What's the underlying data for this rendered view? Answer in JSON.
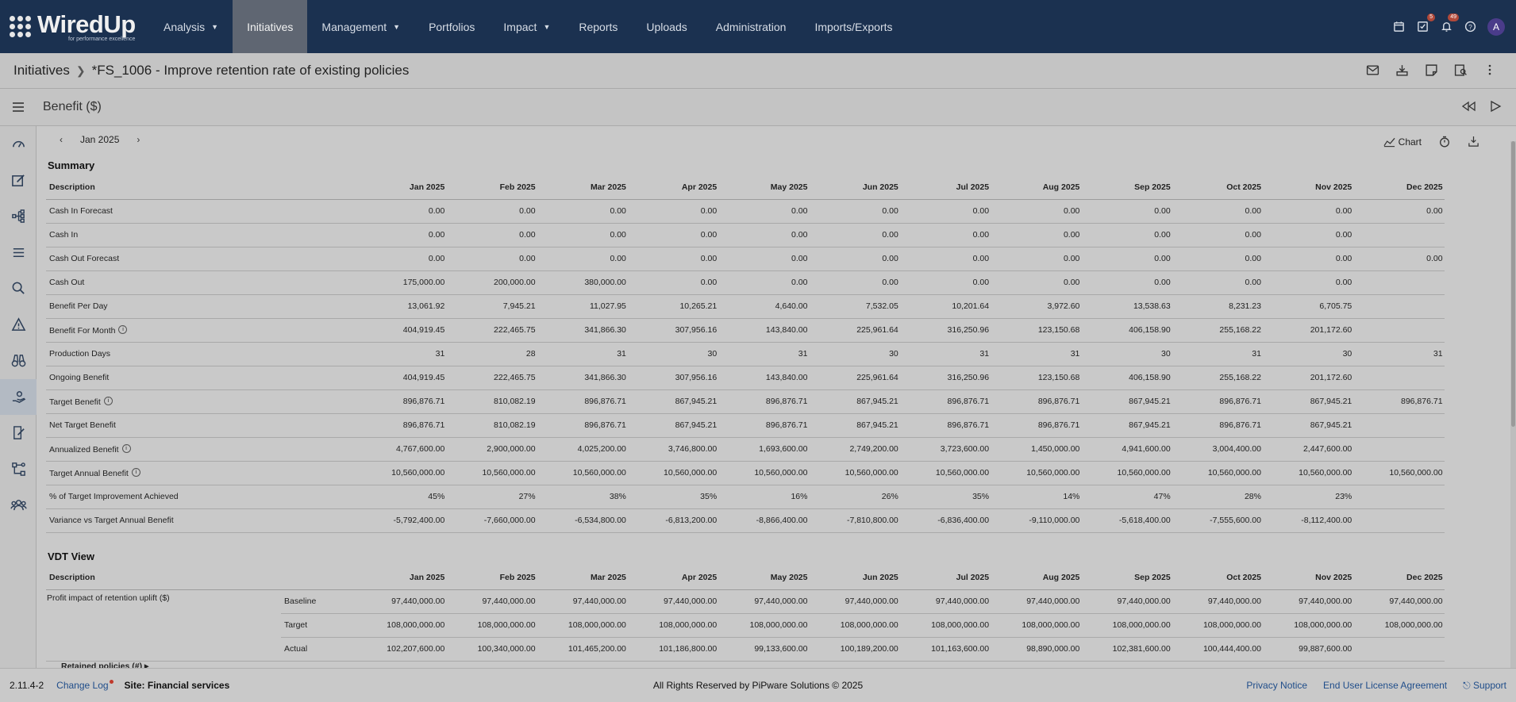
{
  "nav": {
    "logo_text": "WiredUp",
    "logo_tagline": "for performance excellence",
    "items": [
      {
        "label": "Analysis",
        "caret": true
      },
      {
        "label": "Initiatives",
        "caret": false,
        "active": true
      },
      {
        "label": "Management",
        "caret": true
      },
      {
        "label": "Portfolios",
        "caret": false
      },
      {
        "label": "Impact",
        "caret": true
      },
      {
        "label": "Reports",
        "caret": false
      },
      {
        "label": "Uploads",
        "caret": false
      },
      {
        "label": "Administration",
        "caret": false
      },
      {
        "label": "Imports/Exports",
        "caret": false
      }
    ],
    "badge_tasks": "5",
    "badge_notifications": "49",
    "avatar_initial": "A"
  },
  "breadcrumb": {
    "root": "Initiatives",
    "current": "*FS_1006 - Improve retention rate of existing policies"
  },
  "section": {
    "title": "Benefit ($)"
  },
  "period": {
    "label": "Jan 2025"
  },
  "toolbar": {
    "chart_label": "Chart"
  },
  "summary": {
    "title": "Summary",
    "description_header": "Description",
    "months": [
      "Jan 2025",
      "Feb 2025",
      "Mar 2025",
      "Apr 2025",
      "May 2025",
      "Jun 2025",
      "Jul 2025",
      "Aug 2025",
      "Sep 2025",
      "Oct 2025",
      "Nov 2025",
      "Dec 2025"
    ],
    "rows": [
      {
        "label": "Cash In Forecast",
        "info": false,
        "values": [
          "0.00",
          "0.00",
          "0.00",
          "0.00",
          "0.00",
          "0.00",
          "0.00",
          "0.00",
          "0.00",
          "0.00",
          "0.00",
          "0.00"
        ]
      },
      {
        "label": "Cash In",
        "info": false,
        "values": [
          "0.00",
          "0.00",
          "0.00",
          "0.00",
          "0.00",
          "0.00",
          "0.00",
          "0.00",
          "0.00",
          "0.00",
          "0.00",
          ""
        ]
      },
      {
        "label": "Cash Out Forecast",
        "info": false,
        "values": [
          "0.00",
          "0.00",
          "0.00",
          "0.00",
          "0.00",
          "0.00",
          "0.00",
          "0.00",
          "0.00",
          "0.00",
          "0.00",
          "0.00"
        ]
      },
      {
        "label": "Cash Out",
        "info": false,
        "values": [
          "175,000.00",
          "200,000.00",
          "380,000.00",
          "0.00",
          "0.00",
          "0.00",
          "0.00",
          "0.00",
          "0.00",
          "0.00",
          "0.00",
          ""
        ]
      },
      {
        "label": "Benefit Per Day",
        "info": false,
        "highlight": true,
        "values": [
          "13,061.92",
          "7,945.21",
          "11,027.95",
          "10,265.21",
          "4,640.00",
          "7,532.05",
          "10,201.64",
          "3,972.60",
          "13,538.63",
          "8,231.23",
          "6,705.75",
          ""
        ]
      },
      {
        "label": "Benefit For Month",
        "info": true,
        "values": [
          "404,919.45",
          "222,465.75",
          "341,866.30",
          "307,956.16",
          "143,840.00",
          "225,961.64",
          "316,250.96",
          "123,150.68",
          "406,158.90",
          "255,168.22",
          "201,172.60",
          ""
        ]
      },
      {
        "label": "Production Days",
        "info": false,
        "values": [
          "31",
          "28",
          "31",
          "30",
          "31",
          "30",
          "31",
          "31",
          "30",
          "31",
          "30",
          "31"
        ]
      },
      {
        "label": "Ongoing Benefit",
        "info": false,
        "values": [
          "404,919.45",
          "222,465.75",
          "341,866.30",
          "307,956.16",
          "143,840.00",
          "225,961.64",
          "316,250.96",
          "123,150.68",
          "406,158.90",
          "255,168.22",
          "201,172.60",
          ""
        ]
      },
      {
        "label": "Target Benefit",
        "info": true,
        "values": [
          "896,876.71",
          "810,082.19",
          "896,876.71",
          "867,945.21",
          "896,876.71",
          "867,945.21",
          "896,876.71",
          "896,876.71",
          "867,945.21",
          "896,876.71",
          "867,945.21",
          "896,876.71"
        ]
      },
      {
        "label": "Net Target Benefit",
        "info": false,
        "values": [
          "896,876.71",
          "810,082.19",
          "896,876.71",
          "867,945.21",
          "896,876.71",
          "867,945.21",
          "896,876.71",
          "896,876.71",
          "867,945.21",
          "896,876.71",
          "867,945.21",
          ""
        ]
      },
      {
        "label": "Annualized Benefit",
        "info": true,
        "values": [
          "4,767,600.00",
          "2,900,000.00",
          "4,025,200.00",
          "3,746,800.00",
          "1,693,600.00",
          "2,749,200.00",
          "3,723,600.00",
          "1,450,000.00",
          "4,941,600.00",
          "3,004,400.00",
          "2,447,600.00",
          ""
        ]
      },
      {
        "label": "Target Annual Benefit",
        "info": true,
        "values": [
          "10,560,000.00",
          "10,560,000.00",
          "10,560,000.00",
          "10,560,000.00",
          "10,560,000.00",
          "10,560,000.00",
          "10,560,000.00",
          "10,560,000.00",
          "10,560,000.00",
          "10,560,000.00",
          "10,560,000.00",
          "10,560,000.00"
        ]
      },
      {
        "label": "% of Target Improvement Achieved",
        "info": false,
        "values": [
          "45%",
          "27%",
          "38%",
          "35%",
          "16%",
          "26%",
          "35%",
          "14%",
          "47%",
          "28%",
          "23%",
          ""
        ]
      },
      {
        "label": "Variance vs Target Annual Benefit",
        "info": false,
        "values": [
          "-5,792,400.00",
          "-7,660,000.00",
          "-6,534,800.00",
          "-6,813,200.00",
          "-8,866,400.00",
          "-7,810,800.00",
          "-6,836,400.00",
          "-9,110,000.00",
          "-5,618,400.00",
          "-7,555,600.00",
          "-8,112,400.00",
          ""
        ]
      }
    ]
  },
  "vdt": {
    "title": "VDT View",
    "description_header": "Description",
    "metric": "Profit impact of retention uplift ($)",
    "next_metric": "Retained policies (#)",
    "rows": [
      {
        "label": "Baseline",
        "values": [
          "97,440,000.00",
          "97,440,000.00",
          "97,440,000.00",
          "97,440,000.00",
          "97,440,000.00",
          "97,440,000.00",
          "97,440,000.00",
          "97,440,000.00",
          "97,440,000.00",
          "97,440,000.00",
          "97,440,000.00",
          "97,440,000.00"
        ]
      },
      {
        "label": "Target",
        "values": [
          "108,000,000.00",
          "108,000,000.00",
          "108,000,000.00",
          "108,000,000.00",
          "108,000,000.00",
          "108,000,000.00",
          "108,000,000.00",
          "108,000,000.00",
          "108,000,000.00",
          "108,000,000.00",
          "108,000,000.00",
          "108,000,000.00"
        ]
      },
      {
        "label": "Actual",
        "values": [
          "102,207,600.00",
          "100,340,000.00",
          "101,465,200.00",
          "101,186,800.00",
          "99,133,600.00",
          "100,189,200.00",
          "101,163,600.00",
          "98,890,000.00",
          "102,381,600.00",
          "100,444,400.00",
          "99,887,600.00",
          ""
        ]
      }
    ]
  },
  "footer": {
    "version": "2.11.4-2",
    "change_log": "Change Log",
    "site": "Site: Financial services",
    "copyright": "All Rights Reserved by PiPware Solutions © 2025",
    "privacy": "Privacy Notice",
    "eula": "End User License Agreement",
    "support": "Support"
  }
}
